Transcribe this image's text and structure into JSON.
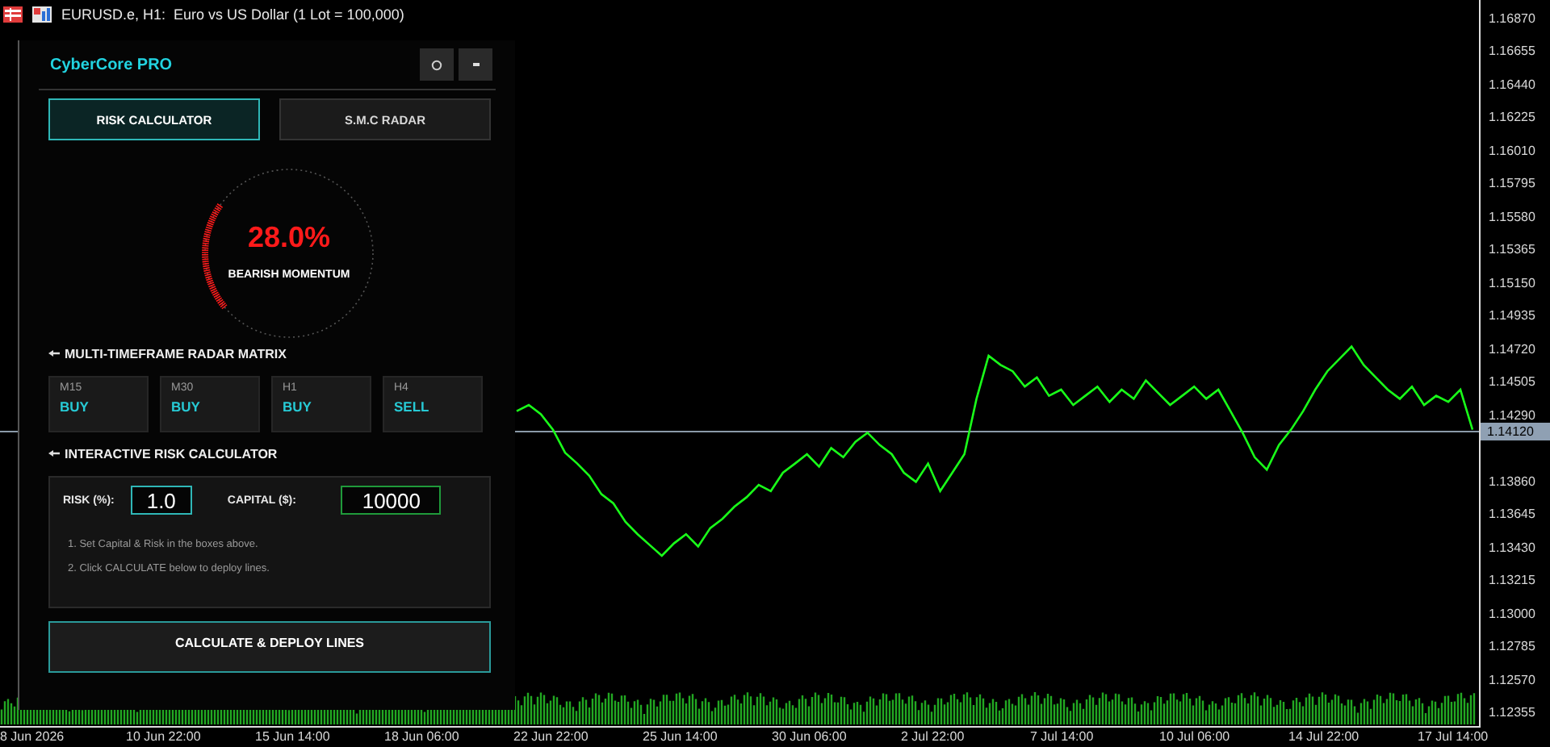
{
  "window": {
    "title": "EURUSD.e, H1:  Euro vs US Dollar (1 Lot = 100,000)"
  },
  "chart": {
    "chart_data": {
      "type": "line",
      "ylim": [
        1.12273,
        1.16993
      ],
      "yticks": [
        {
          "value": 1.1687,
          "label": "1.16870"
        },
        {
          "value": 1.16655,
          "label": "1.16655"
        },
        {
          "value": 1.1644,
          "label": "1.16440"
        },
        {
          "value": 1.16225,
          "label": "1.16225"
        },
        {
          "value": 1.1601,
          "label": "1.16010"
        },
        {
          "value": 1.15795,
          "label": "1.15795"
        },
        {
          "value": 1.1558,
          "label": "1.15580"
        },
        {
          "value": 1.15365,
          "label": "1.15365"
        },
        {
          "value": 1.1515,
          "label": "1.15150"
        },
        {
          "value": 1.14935,
          "label": "1.14935"
        },
        {
          "value": 1.1472,
          "label": "1.14720"
        },
        {
          "value": 1.14505,
          "label": "1.14505"
        },
        {
          "value": 1.1429,
          "label": "1.14290"
        },
        {
          "value": 1.1386,
          "label": "1.13860"
        },
        {
          "value": 1.13645,
          "label": "1.13645"
        },
        {
          "value": 1.1343,
          "label": "1.13430"
        },
        {
          "value": 1.13215,
          "label": "1.13215"
        },
        {
          "value": 1.13,
          "label": "1.13000"
        },
        {
          "value": 1.12785,
          "label": "1.12785"
        },
        {
          "value": 1.1257,
          "label": "1.12570"
        },
        {
          "value": 1.12355,
          "label": "1.12355"
        }
      ],
      "series": [
        {
          "color": "#19ff19",
          "values": [
            1.1432,
            1.1436,
            1.143,
            1.142,
            1.1405,
            1.1398,
            1.139,
            1.1378,
            1.1372,
            1.136,
            1.1352,
            1.1345,
            1.1338,
            1.1346,
            1.1352,
            1.1344,
            1.1356,
            1.1362,
            1.137,
            1.1376,
            1.1384,
            1.138,
            1.1392,
            1.1398,
            1.1404,
            1.1396,
            1.1408,
            1.1402,
            1.1412,
            1.1418,
            1.141,
            1.1404,
            1.1392,
            1.1386,
            1.1398,
            1.138,
            1.1392,
            1.1404,
            1.144,
            1.1468,
            1.1462,
            1.1458,
            1.1448,
            1.1454,
            1.1442,
            1.1446,
            1.1436,
            1.1442,
            1.1448,
            1.1438,
            1.1446,
            1.144,
            1.1452,
            1.1444,
            1.1436,
            1.1442,
            1.1448,
            1.144,
            1.1446,
            1.1432,
            1.1418,
            1.1402,
            1.1394,
            1.141,
            1.142,
            1.1432,
            1.1446,
            1.1458,
            1.1466,
            1.1474,
            1.1462,
            1.1454,
            1.1446,
            1.144,
            1.1448,
            1.1436,
            1.1442,
            1.1438,
            1.1446,
            1.142
          ]
        }
      ]
    },
    "current_price": "1.14120",
    "date_axis": [
      "8 Jun 2026",
      "10 Jun 22:00",
      "15 Jun 14:00",
      "18 Jun 06:00",
      "22 Jun 22:00",
      "25 Jun 14:00",
      "30 Jun 06:00",
      "2 Jul 22:00",
      "7 Jul 14:00",
      "10 Jul 06:00",
      "14 Jul 22:00",
      "17 Jul 14:00"
    ]
  },
  "panel": {
    "title": "CyberCore PRO",
    "tabs": [
      {
        "label": "RISK CALCULATOR",
        "selected": true
      },
      {
        "label": "S.M.C RADAR",
        "selected": false
      }
    ],
    "gauge": {
      "value": "28.0%",
      "caption": "BEARISH MOMENTUM",
      "kind": "bearish"
    },
    "radar": {
      "heading": "MULTI-TIMEFRAME RADAR MATRIX",
      "cells": [
        {
          "timeframe": "M15",
          "signal": "BUY"
        },
        {
          "timeframe": "M30",
          "signal": "BUY"
        },
        {
          "timeframe": "H1",
          "signal": "BUY"
        },
        {
          "timeframe": "H4",
          "signal": "SELL"
        }
      ]
    },
    "calculator": {
      "heading": "INTERACTIVE RISK CALCULATOR",
      "fields": [
        {
          "label": "RISK (%):",
          "value": "1.0",
          "kind": "risk"
        },
        {
          "label": "CAPITAL ($):",
          "value": "10000",
          "kind": "capital"
        }
      ],
      "instructions": [
        "1. Set Capital & Risk in the boxes above.",
        "2. Click CALCULATE below to deploy lines."
      ],
      "button": "CALCULATE & DEPLOY LINES"
    }
  }
}
